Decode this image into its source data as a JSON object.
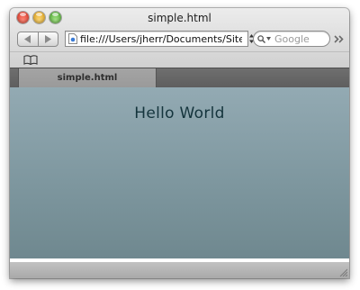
{
  "window": {
    "title": "simple.html"
  },
  "toolbar": {
    "back_icon": "back-arrow-icon",
    "forward_icon": "forward-arrow-icon",
    "address_value": "file:///Users/jherr/Documents/Sites",
    "search_placeholder": "Google"
  },
  "tabs": [
    {
      "label": "simple.html",
      "active": true
    }
  ],
  "page": {
    "heading": "Hello World"
  },
  "colors": {
    "content_top": "#93aab3",
    "content_bottom": "#6f888f",
    "heading_text": "#14343c",
    "tabstrip": "#666666"
  }
}
